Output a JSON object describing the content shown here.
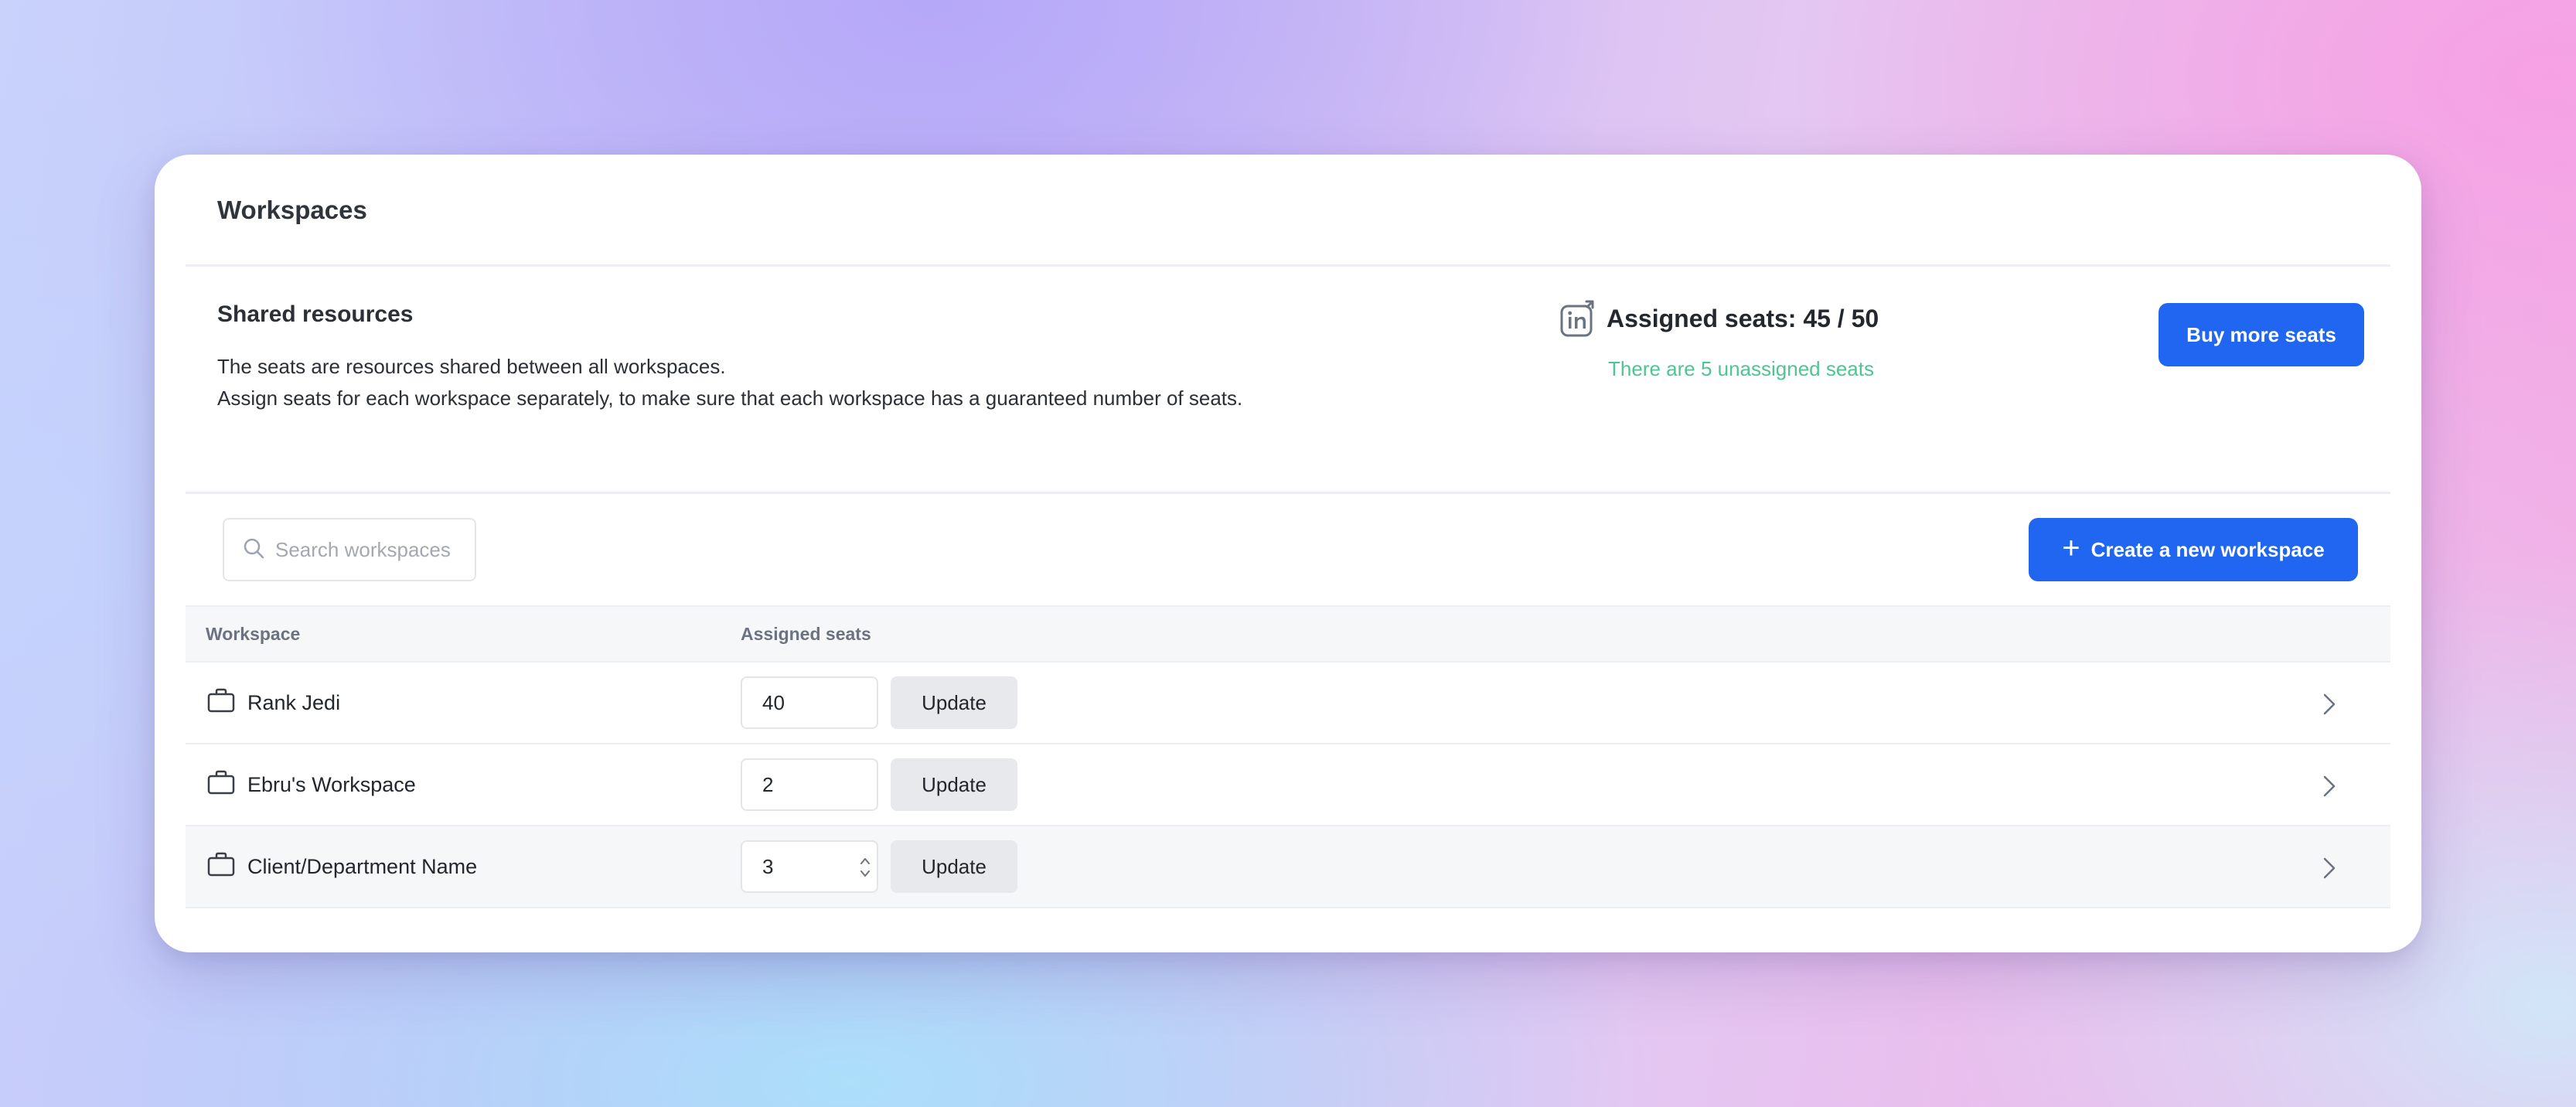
{
  "card": {
    "title": "Workspaces"
  },
  "shared": {
    "title": "Shared resources",
    "desc_line1": "The seats are resources shared between all workspaces.",
    "desc_line2": "Assign seats for each workspace separately, to make sure that each workspace has a guaranteed number of seats."
  },
  "seats": {
    "label": "Assigned seats: 45 / 50",
    "sub": "There are 5 unassigned seats",
    "icon": "linkedin-seat-icon"
  },
  "buttons": {
    "buy": "Buy more seats",
    "create": "Create a new workspace",
    "update": "Update"
  },
  "search": {
    "placeholder": "Search workspaces"
  },
  "table": {
    "headers": [
      "Workspace",
      "Assigned seats"
    ],
    "rows": [
      {
        "name": "Rank Jedi",
        "seats": "40"
      },
      {
        "name": "Ebru's Workspace",
        "seats": "2"
      },
      {
        "name": "Client/Department Name",
        "seats": "3"
      }
    ]
  },
  "colors": {
    "primary": "#2166f0",
    "success_text": "#4fc495"
  }
}
